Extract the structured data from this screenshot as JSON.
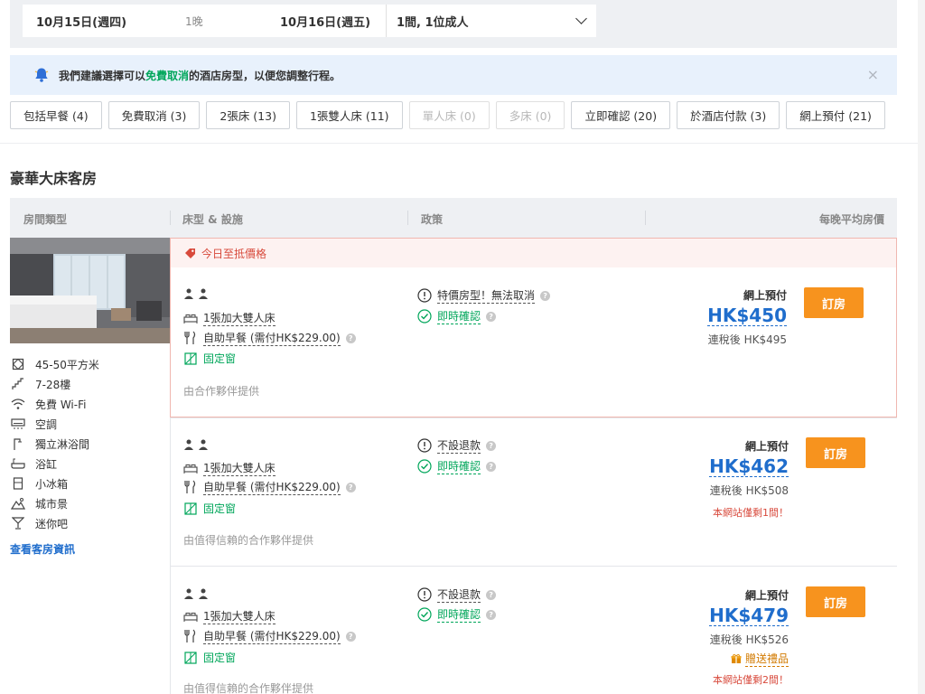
{
  "search": {
    "checkin": "10月15日(週四)",
    "nights": "1晚",
    "checkout": "10月16日(週五)",
    "guests": "1間, 1位成人"
  },
  "notice": {
    "prefix": "我們建議選擇可以",
    "highlight": "免費取消",
    "suffix": "的酒店房型，以便您調整行程。",
    "close": "×"
  },
  "filters": [
    {
      "label": "包括早餐 (4)",
      "disabled": false
    },
    {
      "label": "免費取消 (3)",
      "disabled": false
    },
    {
      "label": "2張床 (13)",
      "disabled": false
    },
    {
      "label": "1張雙人床 (11)",
      "disabled": false
    },
    {
      "label": "單人床 (0)",
      "disabled": true
    },
    {
      "label": "多床 (0)",
      "disabled": true
    },
    {
      "label": "立即確認 (20)",
      "disabled": false
    },
    {
      "label": "於酒店付款 (3)",
      "disabled": false
    },
    {
      "label": "網上預付 (21)",
      "disabled": false
    }
  ],
  "room": {
    "title": "豪華大床客房",
    "features": [
      {
        "icon": "area-icon",
        "label": "45-50平方米"
      },
      {
        "icon": "stairs-icon",
        "label": "7-28樓"
      },
      {
        "icon": "wifi-icon",
        "label": "免費 Wi-Fi"
      },
      {
        "icon": "aircon-icon",
        "label": "空調"
      },
      {
        "icon": "shower-icon",
        "label": "獨立淋浴間"
      },
      {
        "icon": "bathtub-icon",
        "label": "浴缸"
      },
      {
        "icon": "fridge-icon",
        "label": "小冰箱"
      },
      {
        "icon": "cityview-icon",
        "label": "城市景"
      },
      {
        "icon": "minibar-icon",
        "label": "迷你吧"
      }
    ],
    "view_info": "查看客房資訊"
  },
  "table_header": {
    "room_type": "房間類型",
    "bed": "床型 & 設施",
    "policy": "政策",
    "price": "每晚平均房價"
  },
  "deal_label": "今日至抵價格",
  "rates": [
    {
      "guests": "👤👤",
      "bed": "1張加大雙人床",
      "breakfast": "自助早餐 (需付HK$229.00)",
      "window": "固定窗",
      "provider": "由合作夥伴提供",
      "policy": "特價房型！無法取消",
      "confirm": "即時確認",
      "pay_label": "網上預付",
      "price": "HK$450",
      "tax": "連稅後 HK$495",
      "gift": "",
      "scarce": "",
      "book": "訂房"
    },
    {
      "guests": "👤👤",
      "bed": "1張加大雙人床",
      "breakfast": "自助早餐 (需付HK$229.00)",
      "window": "固定窗",
      "provider": "由值得信賴的合作夥伴提供",
      "policy": "不設退款",
      "confirm": "即時確認",
      "pay_label": "網上預付",
      "price": "HK$462",
      "tax": "連稅後 HK$508",
      "gift": "",
      "scarce": "本網站僅剩1間！",
      "book": "訂房"
    },
    {
      "guests": "👤👤",
      "bed": "1張加大雙人床",
      "breakfast": "自助早餐 (需付HK$229.00)",
      "window": "固定窗",
      "provider": "由值得信賴的合作夥伴提供",
      "policy": "不設退款",
      "confirm": "即時確認",
      "pay_label": "網上預付",
      "price": "HK$479",
      "tax": "連稅後 HK$526",
      "gift": "贈送禮品",
      "scarce": "本網站僅剩2間！",
      "book": "訂房"
    }
  ],
  "colors": {
    "accent_blue": "#1f6dcc",
    "book_orange": "#f7931e",
    "green": "#00a65a",
    "deal_red": "#d84a3c"
  }
}
